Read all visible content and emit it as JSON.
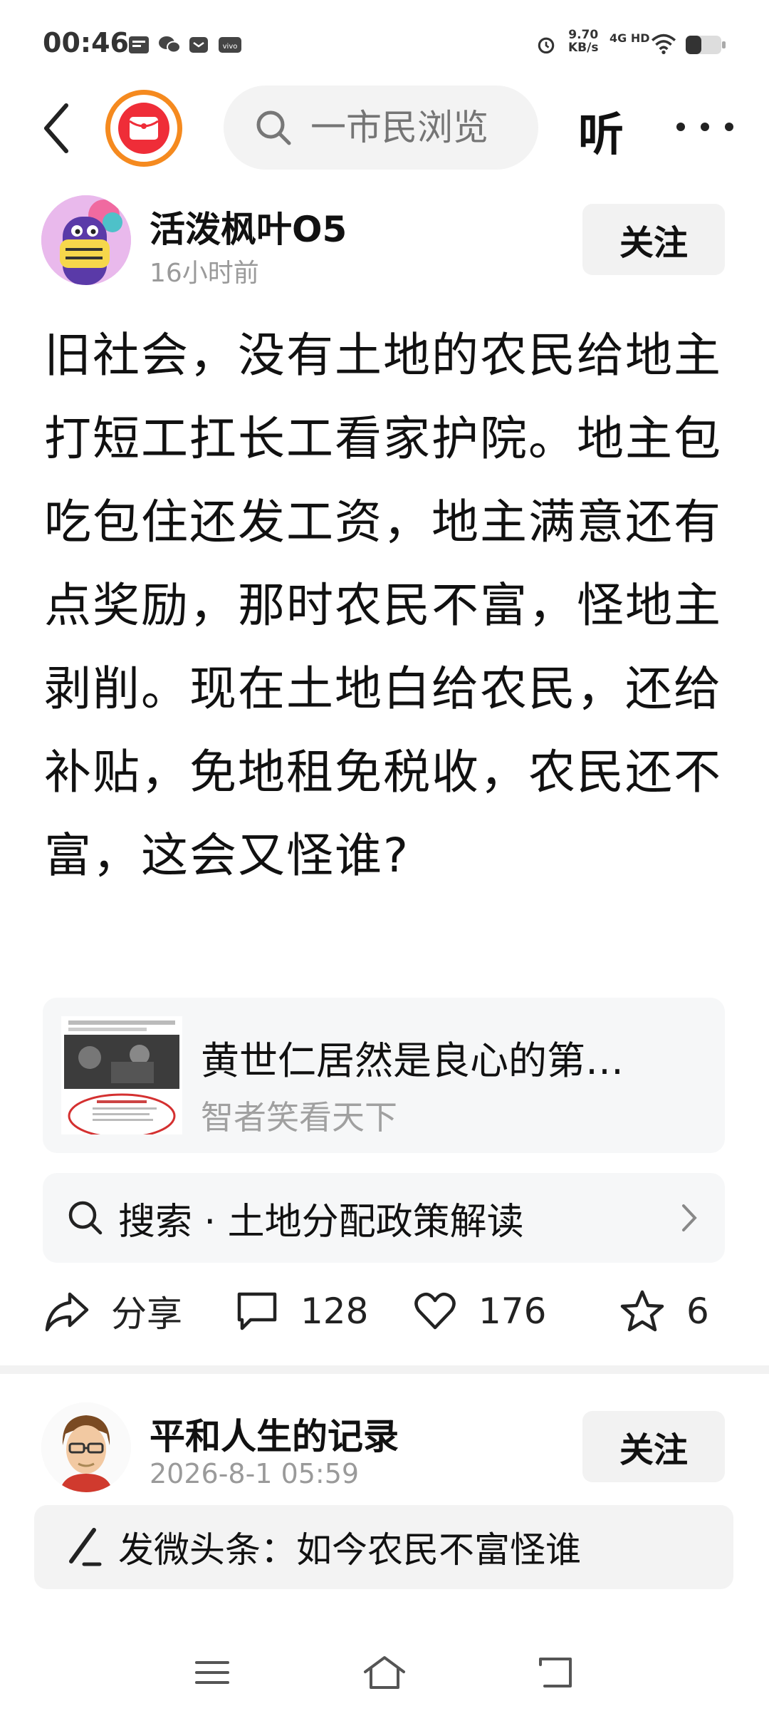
{
  "status_bar": {
    "time": "00:46",
    "net_speed_value": "9.70",
    "net_speed_unit": "KB/s",
    "network_type": "4G HD",
    "icons": [
      "toutiao-icon",
      "wechat-icon",
      "message-icon",
      "vivo-icon",
      "alarm-icon",
      "wifi-icon",
      "battery-icon"
    ]
  },
  "top_nav": {
    "search_placeholder": "一市民浏览",
    "listen_label": "听"
  },
  "post": {
    "author_name": "活泼枫叶O5",
    "time": "16小时前",
    "follow_label": "关注",
    "text": "旧社会，没有土地的农民给地主打短工扛长工看家护院。地主包吃包住还发工资，地主满意还有点奖励，那时农民不富，怪地主剥削。现在土地白给农民，还给补贴，免地租免税收，农民还不富，这会又怪谁?",
    "link_card": {
      "title": "黄世仁居然是良心的第…",
      "source": "智者笑看天下"
    },
    "search_suggestion": "搜索 · 土地分配政策解读",
    "actions": {
      "share_label": "分享",
      "comment_count": "128",
      "like_count": "176",
      "favorite_count": "6"
    }
  },
  "next_post": {
    "author_name": "平和人生的记录",
    "time": "2026-8-1 05:59",
    "follow_label": "关注"
  },
  "compose_bar": {
    "text": "发微头条：如今农民不富怪谁"
  },
  "colors": {
    "logo_ring": "#f58a1f",
    "logo_red": "#ef2d38",
    "card_bg": "#f6f7f8",
    "muted_text": "#9a9a9a"
  }
}
